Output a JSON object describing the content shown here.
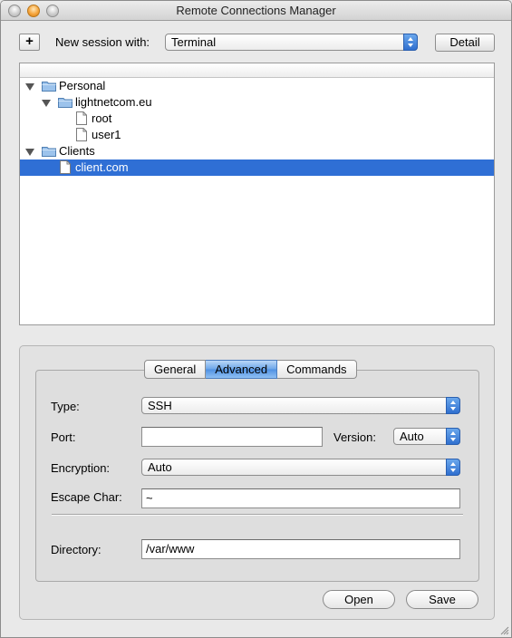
{
  "window": {
    "title": "Remote Connections Manager"
  },
  "toolbar": {
    "add_label": "+",
    "session_label": "New session with:",
    "session_value": "Terminal",
    "detail_label": "Detail"
  },
  "tree": {
    "items": [
      {
        "label": "Personal",
        "kind": "folder",
        "level": 0,
        "expanded": true,
        "selected": false
      },
      {
        "label": "lightnetcom.eu",
        "kind": "folder",
        "level": 1,
        "expanded": true,
        "selected": false
      },
      {
        "label": "root",
        "kind": "document",
        "level": 2,
        "expanded": false,
        "selected": false
      },
      {
        "label": "user1",
        "kind": "document",
        "level": 2,
        "expanded": false,
        "selected": false
      },
      {
        "label": "Clients",
        "kind": "folder",
        "level": 0,
        "expanded": true,
        "selected": false
      },
      {
        "label": "client.com",
        "kind": "document",
        "level": 1,
        "expanded": false,
        "selected": true
      }
    ]
  },
  "tabs": [
    {
      "label": "General",
      "active": false
    },
    {
      "label": "Advanced",
      "active": true
    },
    {
      "label": "Commands",
      "active": false
    }
  ],
  "form": {
    "type_label": "Type:",
    "type_value": "SSH",
    "port_label": "Port:",
    "port_value": "",
    "version_label": "Version:",
    "version_value": "Auto",
    "encryption_label": "Encryption:",
    "encryption_value": "Auto",
    "escape_label": "Escape Char:",
    "escape_value": "~",
    "directory_label": "Directory:",
    "directory_value": "/var/www"
  },
  "buttons": {
    "open_label": "Open",
    "save_label": "Save"
  },
  "colors": {
    "selection": "#2f6fd5",
    "accent": "#3a7ad9"
  }
}
